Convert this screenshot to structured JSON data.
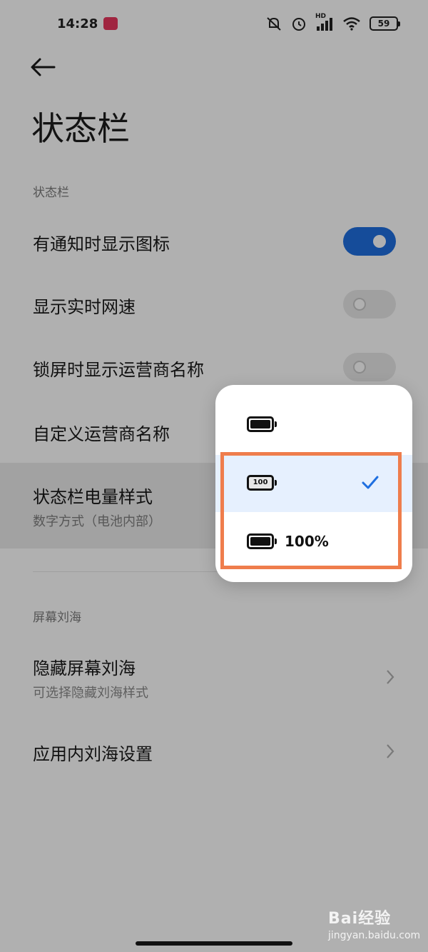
{
  "status_bar": {
    "time": "14:28",
    "network_badge": "HD",
    "battery": "59"
  },
  "page": {
    "title": "状态栏"
  },
  "sections": {
    "status_bar": "状态栏",
    "notch": "屏幕刘海"
  },
  "rows": {
    "show_notification_icons": {
      "label": "有通知时显示图标",
      "enabled": true
    },
    "show_network_speed": {
      "label": "显示实时网速",
      "enabled": false
    },
    "show_carrier_lockscreen": {
      "label": "锁屏时显示运营商名称",
      "enabled": false
    },
    "custom_carrier_name": {
      "label": "自定义运营商名称"
    },
    "battery_style": {
      "label": "状态栏电量样式",
      "value": "数字方式（电池内部）"
    },
    "hide_notch": {
      "label": "隐藏屏幕刘海",
      "sub": "可选择隐藏刘海样式"
    },
    "in_app_notch": {
      "label": "应用内刘海设置"
    }
  },
  "battery_style_menu": {
    "options": [
      {
        "icon": "battery-full-icon",
        "text": "",
        "selected": false
      },
      {
        "icon": "battery-number-inside-icon",
        "text": "100",
        "selected": true
      },
      {
        "icon": "battery-full-icon",
        "text": "100%",
        "selected": false
      }
    ],
    "highlight_color": "#ef7d4c",
    "accent": "#1f6fe0"
  },
  "watermark": {
    "brand": "Bai经验",
    "url": "jingyan.baidu.com"
  }
}
